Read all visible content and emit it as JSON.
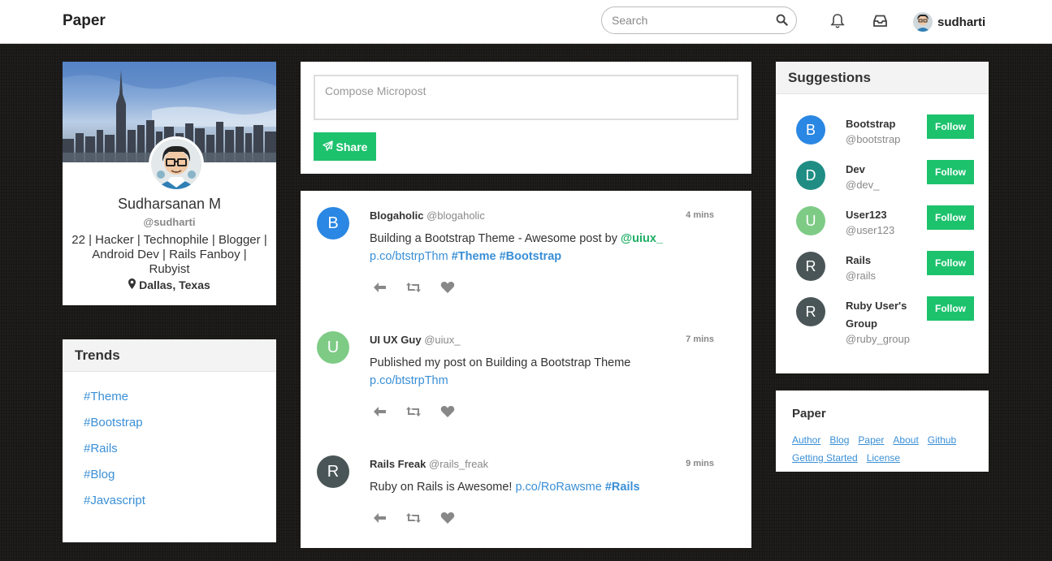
{
  "navbar": {
    "brand": "Paper",
    "search_placeholder": "Search",
    "username": "sudharti"
  },
  "profile": {
    "name": "Sudharsanan M",
    "handle": "@sudharti",
    "bio": "22 | Hacker | Technophile | Blogger | Android Dev | Rails Fanboy | Rubyist",
    "location": "Dallas, Texas"
  },
  "trends": {
    "title": "Trends",
    "items": [
      "#Theme",
      "#Bootstrap",
      "#Rails",
      "#Blog",
      "#Javascript"
    ]
  },
  "compose": {
    "placeholder": "Compose Micropost",
    "share_label": "Share"
  },
  "feed": {
    "posts": [
      {
        "avatar_letter": "B",
        "avatar_color": "#2a87e3",
        "name": "Blogaholic",
        "handle": "@blogaholic",
        "time": "4 mins",
        "text": "Building a Bootstrap Theme - Awesome post by ",
        "mention": "@uiux_",
        "link": "p.co/btstrpThm",
        "tag1": "#Theme",
        "tag2": "#Bootstrap"
      },
      {
        "avatar_letter": "U",
        "avatar_color": "#7ecb86",
        "name": "UI UX Guy",
        "handle": "@uiux_",
        "time": "7 mins",
        "text": "Published my post on Building a Bootstrap Theme",
        "link": "p.co/btstrpThm"
      },
      {
        "avatar_letter": "R",
        "avatar_color": "#4a5557",
        "name": "Rails Freak",
        "handle": "@rails_freak",
        "time": "9 mins",
        "text": "Ruby on Rails is Awesome! ",
        "link": "p.co/RoRawsme",
        "tag": "#Rails"
      }
    ]
  },
  "suggestions": {
    "title": "Suggestions",
    "follow_label": "Follow",
    "items": [
      {
        "letter": "B",
        "color": "#2a87e3",
        "name": "Bootstrap",
        "handle": "@bootstrap"
      },
      {
        "letter": "D",
        "color": "#1f8d84",
        "name": "Dev",
        "handle": "@dev_"
      },
      {
        "letter": "U",
        "color": "#7ecb86",
        "name": "User123",
        "handle": "@user123"
      },
      {
        "letter": "R",
        "color": "#4a5557",
        "name": "Rails",
        "handle": "@rails"
      },
      {
        "letter": "R",
        "color": "#4a5557",
        "name": "Ruby User's Group",
        "handle": "@ruby_group"
      }
    ]
  },
  "footer": {
    "title": "Paper",
    "links": [
      "Author",
      "Blog",
      "Paper",
      "About",
      "Github",
      "Getting Started",
      "License"
    ]
  }
}
